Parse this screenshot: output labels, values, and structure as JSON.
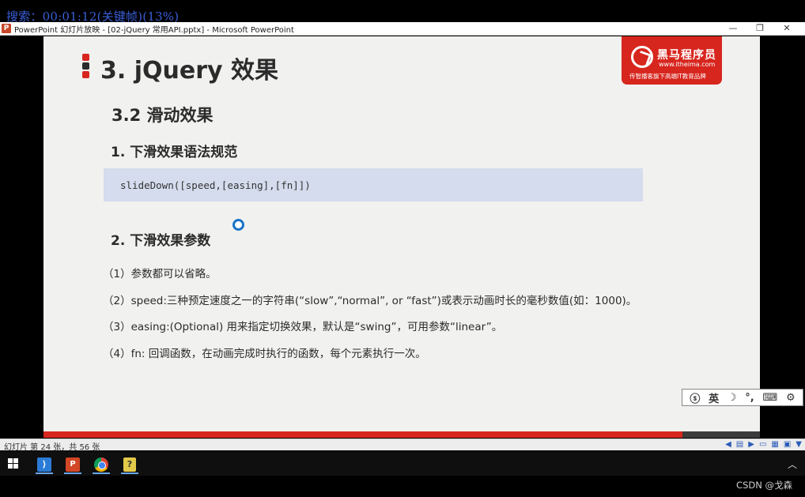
{
  "overlay": {
    "search_text": "搜索：00:01:12(关键帧)(13%)"
  },
  "window": {
    "app_icon_letter": "P",
    "title": "PowerPoint 幻灯片放映 - [02-jQuery 常用API.pptx] - Microsoft PowerPoint",
    "controls": {
      "minimize": "—",
      "restore": "❐",
      "close": "✕"
    }
  },
  "slide": {
    "title": "3. jQuery 效果",
    "section_mark_colors": [
      "#d7261e",
      "#2b2b2b",
      "#d7261e"
    ],
    "logo": {
      "name": "黑马程序员",
      "url": "www.itheima.com",
      "tagline": "传智播客旗下高端IT教育品牌"
    },
    "subtitle": "3.2  滑动效果",
    "heading1": "1. 下滑效果语法规范",
    "code": "slideDown([speed,[easing],[fn]])",
    "heading2": "2. 下滑效果参数",
    "params": [
      "（1）参数都可以省略。",
      "（2）speed:三种预定速度之一的字符串(“slow”,“normal”, or “fast”)或表示动画时长的毫秒数值(如：1000)。",
      "（3）easing:(Optional) 用来指定切换效果，默认是“swing”，可用参数“linear”。",
      "（4）fn:  回调函数，在动画完成时执行的函数，每个元素执行一次。"
    ]
  },
  "ime": {
    "items": [
      "英",
      "☽",
      "°,",
      "⌨",
      "⚙"
    ]
  },
  "status": {
    "slide_info": "幻灯片 第 24 张，共 56 张"
  },
  "taskbar": {
    "apps": [
      {
        "name": "vscode",
        "label": "⟩"
      },
      {
        "name": "powerpoint",
        "label": "P"
      },
      {
        "name": "chrome",
        "label": ""
      },
      {
        "name": "tool",
        "label": "?"
      }
    ]
  },
  "watermark": "CSDN @戈森",
  "colors": {
    "brand_red": "#d7261e",
    "code_bg": "#d4dced",
    "slide_bg": "#f1f1ef"
  }
}
